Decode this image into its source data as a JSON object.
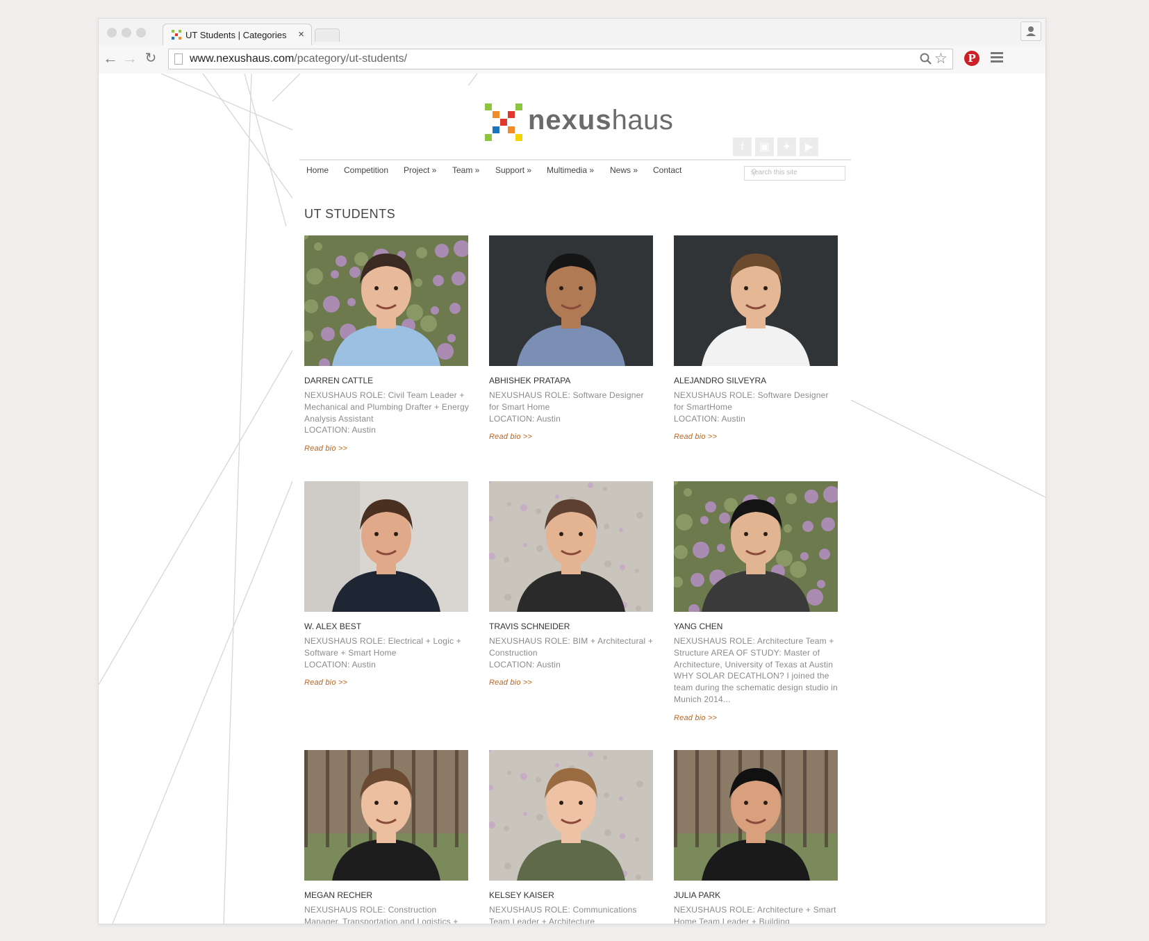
{
  "browser": {
    "tab_title": "UT Students | Categories |",
    "tab_close": "×",
    "url_domain": "www.nexushaus.com",
    "url_path": "/pcategory/ut-students/"
  },
  "site": {
    "logo_text_bold": "nexus",
    "logo_text_light": "haus",
    "search_placeholder": "search this site",
    "nav": [
      "Home",
      "Competition",
      "Project »",
      "Team »",
      "Support »",
      "Multimedia »",
      "News »",
      "Contact"
    ],
    "social_icons": [
      "facebook-icon",
      "instagram-icon",
      "twitter-icon",
      "youtube-icon"
    ],
    "heading": "UT STUDENTS"
  },
  "students": [
    {
      "name": "DARREN CATTLE",
      "role": "NEXUSHAUS ROLE: Civil Team Leader + Mechanical and Plumbing Drafter + Energy Analysis Assistant\nLOCATION: Austin",
      "read_bio": "Read bio >>",
      "photo_bg": "flowers",
      "skin": "#e8b99a",
      "hair": "#3a2a22",
      "shirt": "#9cc0e2"
    },
    {
      "name": "ABHISHEK PRATAPA",
      "role": "NEXUSHAUS ROLE: Software Designer for Smart Home\nLOCATION: Austin",
      "read_bio": "Read bio >>",
      "photo_bg": "dark",
      "skin": "#b07a55",
      "hair": "#151515",
      "shirt": "#7a8fb3"
    },
    {
      "name": "ALEJANDRO SILVEYRA",
      "role": "NEXUSHAUS ROLE: Software Designer for SmartHome\nLOCATION: Austin",
      "read_bio": "Read bio >>",
      "photo_bg": "dark",
      "skin": "#e6b795",
      "hair": "#6b4a2e",
      "shirt": "#f2f2f2"
    },
    {
      "name": "W. ALEX BEST",
      "role": "NEXUSHAUS ROLE: Electrical + Logic + Software + Smart Home\nLOCATION: Austin",
      "read_bio": "Read bio >>",
      "photo_bg": "light",
      "skin": "#e0a98a",
      "hair": "#4a3020",
      "shirt": "#1e2634"
    },
    {
      "name": "TRAVIS SCHNEIDER",
      "role": "NEXUSHAUS ROLE: BIM + Architectural + Construction\nLOCATION: Austin",
      "read_bio": "Read bio >>",
      "photo_bg": "stone",
      "skin": "#e4b392",
      "hair": "#5e4030",
      "shirt": "#2a2a2a"
    },
    {
      "name": "YANG CHEN",
      "role": "NEXUSHAUS ROLE: Architecture Team + Structure AREA OF STUDY: Master of Architecture, University of Texas at Austin WHY SOLAR DECATHLON? I joined the team during the schematic design studio in Munich 2014...",
      "read_bio": "Read bio >>",
      "photo_bg": "flowers",
      "skin": "#e2b592",
      "hair": "#141414",
      "shirt": "#3a3a3a"
    },
    {
      "name": "MEGAN RECHER",
      "role": "NEXUSHAUS ROLE: Construction Manager, Transportation and Logistics +",
      "read_bio": "",
      "photo_bg": "park",
      "skin": "#ecbfa0",
      "hair": "#6a4a30",
      "shirt": "#1d1d1d"
    },
    {
      "name": "KELSEY KAISER",
      "role": "NEXUSHAUS ROLE: Communications Team Leader + Architecture",
      "read_bio": "",
      "photo_bg": "stone",
      "skin": "#eec2a5",
      "hair": "#9a6a40",
      "shirt": "#5f6a4a"
    },
    {
      "name": "JULIA PARK",
      "role": "NEXUSHAUS ROLE: Architecture + Smart Home Team Leader + Building",
      "read_bio": "",
      "photo_bg": "park",
      "skin": "#d9a07e",
      "hair": "#111111",
      "shirt": "#1a1a1a"
    }
  ],
  "colors": {
    "accent_link": "#c0631a",
    "logo_orange": "#f28c28",
    "logo_green": "#8cc63f",
    "logo_blue": "#1c75bc",
    "logo_red": "#e2372d",
    "logo_yellow": "#f5d300",
    "pinterest": "#cb2027"
  }
}
